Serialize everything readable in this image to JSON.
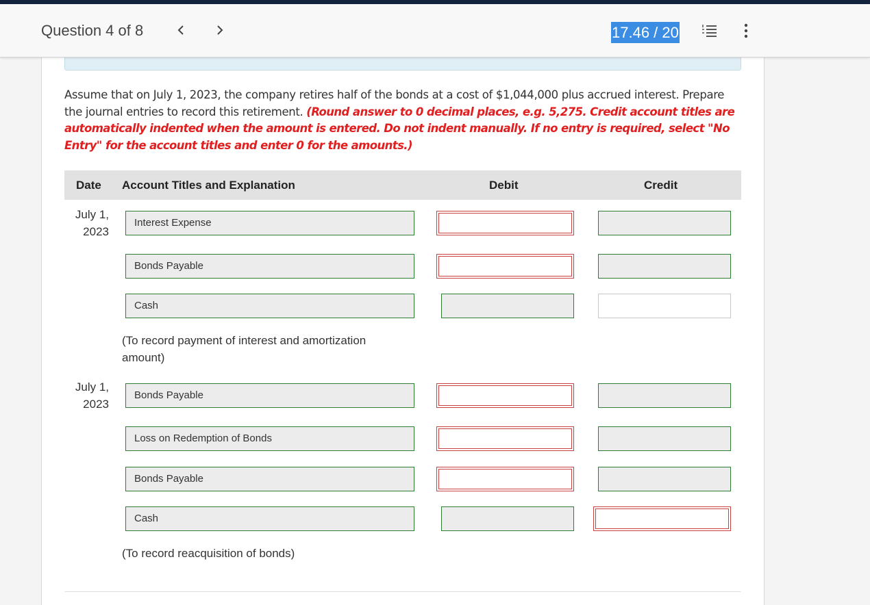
{
  "header": {
    "question_label": "Question 4 of 8",
    "prev_symbol": "‹",
    "next_symbol": "›",
    "score": "17.46 / 20"
  },
  "prompt": {
    "text": "Assume that on July 1, 2023, the company retires half of the bonds at a cost of $1,044,000 plus accrued interest. Prepare the journal entries to record this retirement. ",
    "instructions": "(Round answer to 0 decimal places, e.g. 5,275. Credit account titles are automatically indented when the amount is entered. Do not indent manually. If no entry is required, select \"No Entry\" for the account titles and enter 0 for the amounts.)"
  },
  "table": {
    "headers": {
      "date": "Date",
      "account": "Account Titles and Explanation",
      "debit": "Debit",
      "credit": "Credit"
    },
    "entry1": {
      "date_line1": "July 1,",
      "date_line2": "2023",
      "rows": [
        {
          "account": "Interest Expense",
          "debit": "",
          "credit": ""
        },
        {
          "account": "Bonds Payable",
          "debit": "",
          "credit": ""
        },
        {
          "account": "Cash",
          "debit": "",
          "credit": ""
        }
      ],
      "note": "(To record payment of interest and amortization amount)"
    },
    "entry2": {
      "date_line1": "July 1,",
      "date_line2": "2023",
      "rows": [
        {
          "account": "Bonds Payable",
          "debit": "",
          "credit": ""
        },
        {
          "account": "Loss on Redemption of Bonds",
          "debit": "",
          "credit": ""
        },
        {
          "account": "Bonds Payable",
          "debit": "",
          "credit": ""
        },
        {
          "account": "Cash",
          "debit": "",
          "credit": ""
        }
      ],
      "note": "(To record reacquisition of bonds)"
    }
  },
  "colors": {
    "header_stripe": "#14233d",
    "score_highlight": "#3b8de3",
    "instruction_red": "#e02020",
    "field_border_green": "#2e7d32",
    "error_border_red": "#c84040"
  }
}
